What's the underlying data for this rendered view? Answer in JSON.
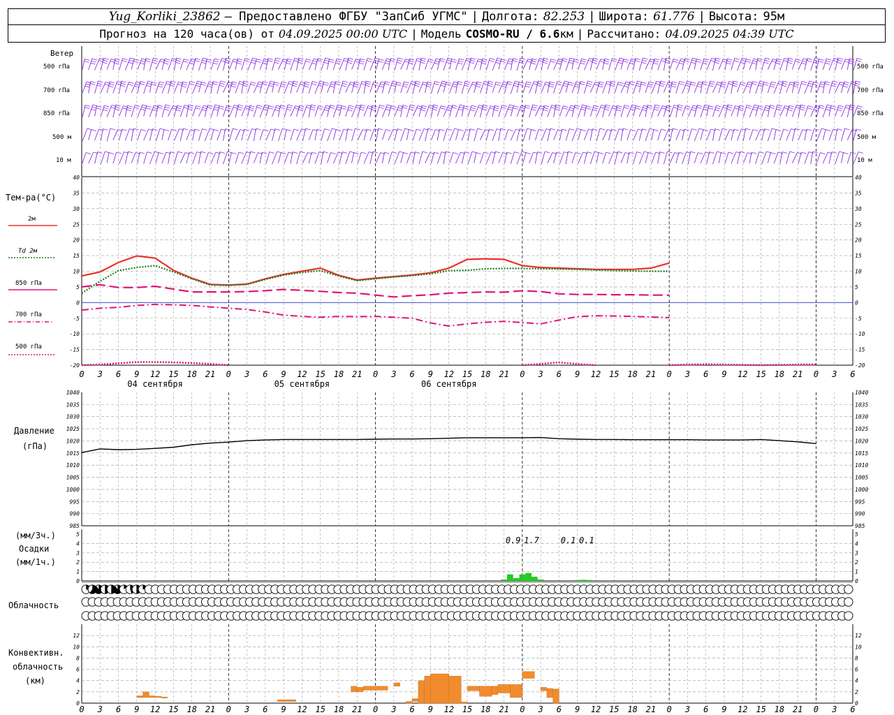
{
  "header": {
    "station": "Yug_Korliki_23862",
    "provider": "– Предоставлено ФГБУ \"ЗапСиб УГМС\"",
    "lon_label": "Долгота:",
    "lon_value": "82.253",
    "lat_label": "Широта:",
    "lat_value": "61.776",
    "alt_label": "Высота:",
    "alt_value": "95м",
    "forecast_prefix": "Прогноз на 120 часа(ов) от",
    "forecast_start": "04.09.2025 00:00 UTC",
    "model_label": "Модель",
    "model_value": "COSMO-RU / 6.6",
    "model_unit": "км",
    "calc_label": "Рассчитано:",
    "calc_value": "04.09.2025 04:39 UTC",
    "separator": "|"
  },
  "labels": {
    "wind_title": "Ветер",
    "wind_levels": [
      "500 гПа",
      "700 гПа",
      "850 гПа",
      "500 м",
      "10  м"
    ],
    "temp_title": "Тем-ра(°С)",
    "legend": [
      {
        "key": "t2m",
        "label": "2м"
      },
      {
        "key": "td2m",
        "label": "Td  2м"
      },
      {
        "key": "t850",
        "label": "850 гПа"
      },
      {
        "key": "t700",
        "label": "700 гПа"
      },
      {
        "key": "t500",
        "label": "500 гПа"
      }
    ],
    "pressure_title": "Давление",
    "pressure_unit": "(гПа)",
    "precip_unit_top": "(мм/3ч.)",
    "precip_title": "Осадки",
    "precip_unit_bottom": "(мм/1ч.)",
    "cloud_title": "Облачность",
    "conv_title_1": "Конвективн.",
    "conv_title_2": "облачность",
    "conv_unit": "(км)"
  },
  "colors": {
    "wind": "#8a2be2",
    "t2m": "#e8332a",
    "td2m": "#1a7a1a",
    "upper": "#e0137a",
    "zero_line": "#2233cc",
    "precip": "#22cc22",
    "convective": "#f08c2e",
    "grid": "#9a9a9a"
  },
  "chart_data": [
    {
      "type": "line",
      "name": "temperature",
      "x_hours": [
        0,
        3,
        6,
        9,
        12,
        15,
        18,
        21,
        24,
        27,
        30,
        33,
        36,
        39,
        42,
        45,
        48,
        51,
        54,
        57,
        60,
        63,
        66,
        69,
        72,
        75,
        78,
        81,
        84,
        87,
        90,
        93,
        96,
        99,
        102,
        105,
        108,
        111,
        114,
        117,
        120
      ],
      "ylim": [
        -20,
        40
      ],
      "yticks": [
        -20,
        -15,
        -10,
        -5,
        0,
        5,
        10,
        15,
        20,
        25,
        30,
        35,
        40
      ],
      "series": [
        {
          "key": "t2m",
          "values": [
            8.5,
            9.8,
            12.8,
            14.9,
            14.2,
            10.3,
            7.8,
            5.8,
            5.6,
            5.9,
            7.6,
            9.0,
            10.0,
            11.0,
            8.7,
            7.2,
            7.8,
            8.3,
            8.8,
            9.5,
            11.0,
            13.8,
            14.0,
            13.8,
            11.8,
            11.2,
            11.0,
            10.8,
            10.6,
            10.6,
            10.6,
            11.0,
            12.6
          ]
        },
        {
          "key": "td2m",
          "values": [
            3.0,
            6.8,
            10.2,
            11.2,
            11.8,
            9.8,
            7.6,
            5.6,
            5.5,
            5.8,
            7.4,
            8.8,
            9.6,
            10.2,
            8.5,
            7.0,
            7.6,
            8.2,
            8.6,
            9.2,
            10.2,
            10.3,
            10.8,
            10.9,
            10.9,
            10.8,
            10.7,
            10.6,
            10.4,
            10.2,
            10.1,
            10.0,
            10.0
          ]
        },
        {
          "key": "t850",
          "values": [
            5.0,
            5.7,
            4.8,
            4.8,
            5.2,
            4.3,
            3.4,
            3.4,
            3.4,
            3.5,
            3.8,
            4.2,
            3.9,
            3.6,
            3.2,
            3.0,
            2.4,
            1.8,
            2.2,
            2.5,
            3.0,
            3.2,
            3.4,
            3.3,
            3.8,
            3.5,
            2.8,
            2.6,
            2.6,
            2.5,
            2.5,
            2.4,
            2.4
          ]
        },
        {
          "key": "t700",
          "values": [
            -2.4,
            -1.8,
            -1.5,
            -0.9,
            -0.6,
            -0.7,
            -0.9,
            -1.4,
            -1.8,
            -2.2,
            -3.0,
            -4.0,
            -4.4,
            -4.7,
            -4.4,
            -4.5,
            -4.4,
            -4.7,
            -5.0,
            -6.5,
            -7.5,
            -6.8,
            -6.3,
            -6.0,
            -6.4,
            -6.8,
            -5.6,
            -4.5,
            -4.2,
            -4.3,
            -4.4,
            -4.6,
            -4.8
          ]
        },
        {
          "key": "t500",
          "segments": [
            {
              "x": [
                0,
                3,
                6,
                9,
                12,
                15,
                18,
                21,
                24
              ],
              "values": [
                -20.0,
                -19.8,
                -19.4,
                -19.0,
                -19.0,
                -19.1,
                -19.3,
                -19.6,
                -20.0
              ]
            },
            {
              "x": [
                72,
                75,
                78,
                81,
                84
              ],
              "values": [
                -20.0,
                -19.6,
                -19.1,
                -19.6,
                -20.0
              ]
            },
            {
              "x": [
                96,
                99,
                102,
                105,
                108,
                111,
                114,
                117,
                120
              ],
              "values": [
                -20.0,
                -19.8,
                -19.7,
                -19.8,
                -19.9,
                -20.0,
                -19.9,
                -19.8,
                -19.8
              ]
            }
          ]
        }
      ],
      "x_tick_labels": [
        "0",
        "3",
        "6",
        "9",
        "12",
        "15",
        "18",
        "21"
      ],
      "date_labels": [
        "04 сентября",
        "05 сентября",
        "06 сентября"
      ]
    },
    {
      "type": "line",
      "name": "pressure",
      "ylim": [
        985,
        1040
      ],
      "yticks": [
        985,
        990,
        995,
        1000,
        1005,
        1010,
        1015,
        1020,
        1025,
        1030,
        1035,
        1040
      ],
      "x_hours": [
        0,
        3,
        6,
        9,
        12,
        15,
        18,
        21,
        24,
        27,
        30,
        33,
        36,
        39,
        42,
        45,
        48,
        51,
        54,
        57,
        60,
        63,
        66,
        69,
        72,
        75,
        78,
        81,
        84,
        87,
        90,
        93,
        96,
        99,
        102,
        105,
        108,
        111,
        114,
        117,
        120
      ],
      "values": [
        1015.2,
        1016.7,
        1016.4,
        1016.5,
        1016.9,
        1017.4,
        1018.4,
        1019.1,
        1019.5,
        1020.1,
        1020.4,
        1020.6,
        1020.6,
        1020.6,
        1020.6,
        1020.6,
        1020.7,
        1020.8,
        1020.8,
        1020.9,
        1021.1,
        1021.3,
        1021.3,
        1021.3,
        1021.3,
        1021.4,
        1020.9,
        1020.7,
        1020.6,
        1020.6,
        1020.5,
        1020.5,
        1020.5,
        1020.5,
        1020.4,
        1020.4,
        1020.4,
        1020.6,
        1020.1,
        1019.6,
        1018.9
      ]
    },
    {
      "type": "bar",
      "name": "precipitation",
      "ylim": [
        0,
        5
      ],
      "yticks": [
        0,
        1,
        2,
        3,
        4,
        5
      ],
      "bars_1h": [
        {
          "x": 69,
          "value": 0.15
        },
        {
          "x": 70,
          "value": 0.7
        },
        {
          "x": 71,
          "value": 0.3
        },
        {
          "x": 72,
          "value": 0.7
        },
        {
          "x": 73,
          "value": 0.85
        },
        {
          "x": 74,
          "value": 0.45
        },
        {
          "x": 75,
          "value": 0.15
        },
        {
          "x": 81,
          "value": 0.1
        },
        {
          "x": 82,
          "value": 0.12
        },
        {
          "x": 83,
          "value": 0.1
        }
      ],
      "totals_3h": [
        {
          "x": 70.5,
          "label": "0.9"
        },
        {
          "x": 73.5,
          "label": "1.7"
        },
        {
          "x": 79.5,
          "label": "0.1"
        },
        {
          "x": 82.5,
          "label": "0.1"
        }
      ]
    },
    {
      "type": "table",
      "name": "cloudiness",
      "rows": 3,
      "levels": [
        "high",
        "middle",
        "low"
      ],
      "coverage_fraction_per_hour": {
        "high": [
          0.3,
          0.6,
          0.9,
          0.5,
          0.5,
          0.9,
          0.15,
          0.45,
          0.5,
          0.25,
          0,
          0,
          0,
          0,
          0,
          0,
          0,
          0,
          0,
          0,
          0,
          0,
          0,
          0,
          0,
          0,
          0,
          0,
          0,
          0,
          0,
          0,
          0,
          0,
          0,
          0,
          0,
          0,
          0,
          0,
          0,
          0,
          0,
          0,
          0,
          0,
          0,
          0,
          0,
          0,
          0,
          0,
          0,
          0,
          0,
          0,
          0,
          0,
          0,
          0,
          0,
          0,
          0,
          0,
          0,
          0,
          0,
          0,
          0,
          0,
          0,
          0,
          0,
          0,
          0,
          0,
          0,
          0,
          0,
          0,
          0,
          0,
          0,
          0,
          0,
          0,
          0,
          0,
          0,
          0,
          0,
          0,
          0,
          0,
          0,
          0,
          0,
          0,
          0,
          0,
          0,
          0,
          0,
          0,
          0,
          0,
          0,
          0,
          0,
          0,
          0,
          0,
          0,
          0,
          0,
          0,
          0,
          0,
          0,
          0,
          0
        ],
        "middle": [
          0,
          0,
          0,
          0,
          0,
          0,
          0,
          0,
          0,
          0,
          0,
          0,
          0,
          0,
          0,
          0,
          0,
          0,
          0,
          0,
          0,
          0,
          0,
          0,
          0,
          0,
          0,
          0,
          0,
          0,
          0,
          0,
          0,
          0,
          0,
          0,
          0,
          0,
          0,
          0,
          0,
          0,
          0,
          0,
          0,
          0,
          0,
          0,
          0,
          0,
          0,
          0,
          0,
          0,
          0,
          0,
          0,
          0,
          0,
          0,
          0,
          0,
          0,
          0,
          0,
          0,
          0,
          0,
          0,
          0,
          0,
          0,
          0,
          0,
          0,
          0,
          0,
          0,
          0,
          0,
          0,
          0,
          0,
          0,
          0,
          0,
          0,
          0,
          0,
          0,
          0,
          0,
          0,
          0,
          0,
          0,
          0,
          0,
          0,
          0,
          0,
          0,
          0,
          0,
          0,
          0,
          0,
          0,
          0,
          0,
          0,
          0,
          0,
          0,
          0,
          0,
          0,
          0,
          0,
          0,
          0
        ],
        "low": [
          0,
          0,
          0,
          0,
          0,
          0,
          0,
          0,
          0,
          0,
          0,
          0,
          0,
          0,
          0,
          0,
          0,
          0,
          0,
          0,
          0,
          0,
          0,
          0,
          0,
          0,
          0,
          0,
          0,
          0,
          0,
          0,
          0,
          0,
          0,
          0,
          0,
          0,
          0,
          0,
          0,
          0,
          0,
          0,
          0,
          0,
          0,
          0,
          0,
          0,
          0,
          0,
          0,
          0,
          0,
          0,
          0,
          0,
          0,
          0,
          0,
          0,
          0,
          0,
          0,
          0,
          0,
          0,
          0,
          0,
          0,
          0,
          0,
          0,
          0,
          0,
          0,
          0,
          0,
          0,
          0,
          0,
          0,
          0,
          0,
          0,
          0,
          0,
          0,
          0,
          0,
          0,
          0,
          0,
          0,
          0,
          0,
          0,
          0,
          0,
          0,
          0,
          0,
          0,
          0,
          0,
          0,
          0,
          0,
          0,
          0,
          0,
          0,
          0,
          0,
          0,
          0,
          0,
          0,
          0,
          0
        ]
      }
    },
    {
      "type": "bar",
      "name": "convective_clouds",
      "ylim": [
        0,
        14
      ],
      "yticks": [
        0,
        2,
        4,
        6,
        8,
        10,
        12
      ],
      "cells": [
        {
          "x0": 9,
          "x1": 10,
          "base": 1.0,
          "top": 1.3
        },
        {
          "x0": 10,
          "x1": 11,
          "base": 1.0,
          "top": 2.0
        },
        {
          "x0": 11,
          "x1": 12,
          "base": 1.0,
          "top": 1.3
        },
        {
          "x0": 12,
          "x1": 13,
          "base": 1.0,
          "top": 1.2
        },
        {
          "x0": 13,
          "x1": 14,
          "base": 0.9,
          "top": 1.1
        },
        {
          "x0": 32,
          "x1": 35,
          "base": 0.3,
          "top": 0.6
        },
        {
          "x0": 44,
          "x1": 45,
          "base": 2.0,
          "top": 3.0
        },
        {
          "x0": 45,
          "x1": 46,
          "base": 2.0,
          "top": 2.8
        },
        {
          "x0": 46,
          "x1": 50,
          "base": 2.3,
          "top": 3.0
        },
        {
          "x0": 51,
          "x1": 52,
          "base": 3.0,
          "top": 3.6
        },
        {
          "x0": 53,
          "x1": 54,
          "base": 0.0,
          "top": 0.3
        },
        {
          "x0": 54,
          "x1": 55,
          "base": 0.3,
          "top": 0.8
        },
        {
          "x0": 55,
          "x1": 56,
          "base": 0.0,
          "top": 4.0
        },
        {
          "x0": 56,
          "x1": 57,
          "base": 0.0,
          "top": 4.8
        },
        {
          "x0": 57,
          "x1": 60,
          "base": 0.0,
          "top": 5.2
        },
        {
          "x0": 60,
          "x1": 62,
          "base": 0.0,
          "top": 4.8
        },
        {
          "x0": 62,
          "x1": 63,
          "base": 0.0,
          "top": 0.2
        },
        {
          "x0": 63,
          "x1": 65,
          "base": 2.2,
          "top": 3.0
        },
        {
          "x0": 65,
          "x1": 67,
          "base": 1.2,
          "top": 3.0
        },
        {
          "x0": 67,
          "x1": 68,
          "base": 1.5,
          "top": 3.0
        },
        {
          "x0": 68,
          "x1": 70,
          "base": 1.8,
          "top": 3.3
        },
        {
          "x0": 70,
          "x1": 72,
          "base": 1.0,
          "top": 3.3
        },
        {
          "x0": 72,
          "x1": 74,
          "base": 4.4,
          "top": 5.6
        },
        {
          "x0": 75,
          "x1": 76,
          "base": 2.2,
          "top": 2.8
        },
        {
          "x0": 76,
          "x1": 77,
          "base": 1.0,
          "top": 2.6
        },
        {
          "x0": 77,
          "x1": 78,
          "base": 0.0,
          "top": 2.5
        }
      ]
    }
  ]
}
